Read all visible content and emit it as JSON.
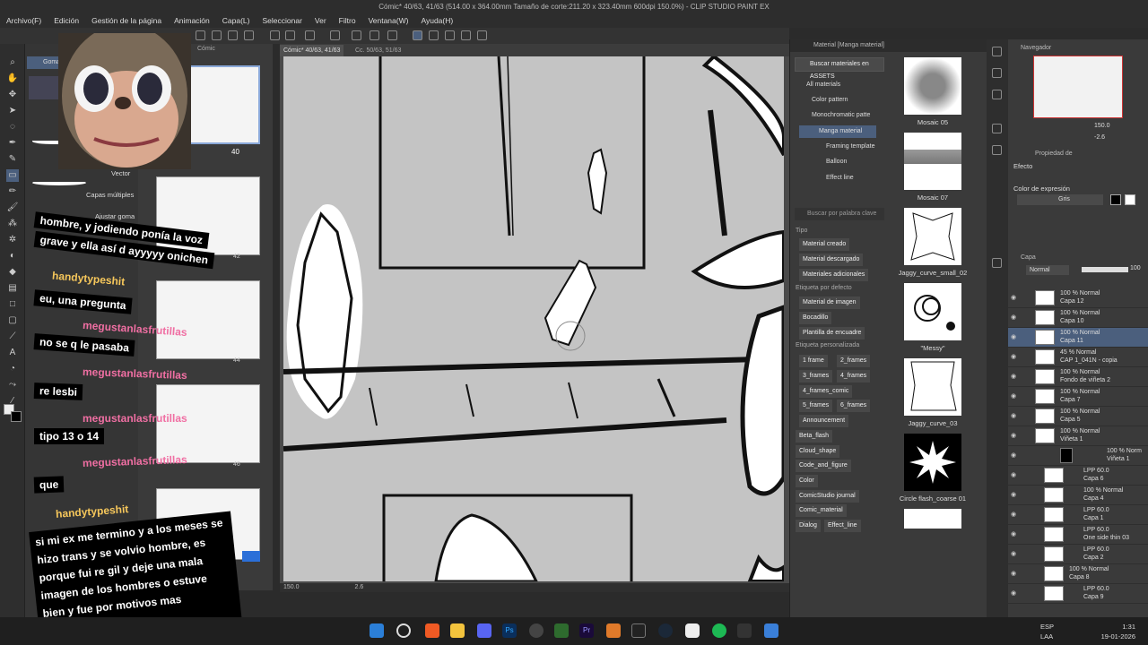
{
  "titlebar": "Cómic* 40/63, 41/63 (514.00 x 364.00mm Tamaño de corte:211.20 x 323.40mm 600dpi 150.0%) - CLIP STUDIO PAINT EX",
  "menu": [
    "Archivo(F)",
    "Edición",
    "Gestión de la página",
    "Animación",
    "Capa(L)",
    "Seleccionar",
    "Ver",
    "Filtro",
    "Ventana(W)",
    "Ayuda(H)"
  ],
  "subtool": {
    "active": "Goma",
    "items": [
      "Vector",
      "Capas múltiples",
      "Ajustar goma"
    ]
  },
  "pages": {
    "tab": "Cómic",
    "labels": [
      "40",
      "42",
      "44",
      "46"
    ]
  },
  "canvas": {
    "tabs": [
      "Cómic* 40/63, 41/63",
      "Cc. 50/63, 51/63"
    ],
    "zoom": "150.0",
    "angle": "2.6"
  },
  "material": {
    "header": "Material [Manga material]",
    "assets_button": "Buscar materiales en ASSETS",
    "tree": [
      "All materials",
      "Color pattern",
      "Monochromatic patte",
      "Manga material",
      "Framing template",
      "Balloon",
      "Effect line"
    ],
    "search_placeholder": "Buscar por palabra clave",
    "sections": [
      "Tipo",
      "Etiqueta por defecto",
      "Etiqueta personalizada"
    ],
    "tags_tipo": [
      "Material creado",
      "Material descargado",
      "Materiales adicionales"
    ],
    "tags_default": [
      "Material de imagen",
      "Bocadillo",
      "Plantilla de encuadre"
    ],
    "tags_custom": [
      "1 frame",
      "2_frames",
      "3_frames",
      "4_frames",
      "4_frames_comic",
      "5_frames",
      "6_frames",
      "Announcement",
      "Beta_flash",
      "Cloud_shape",
      "Code_and_figure",
      "Color",
      "ComicStudio journal",
      "Comic_material",
      "Dialog",
      "Effect_line"
    ],
    "items": [
      "Mosaic 05",
      "Mosaic 07",
      "Jaggy_curve_small_02",
      "\"Messy\"",
      "Jaggy_curve_03",
      "Circle flash_coarse 01"
    ]
  },
  "navigator": {
    "title": "Navegador",
    "zoom": "150.0",
    "angle": "-2.6"
  },
  "props": {
    "title": "Propiedad de",
    "effect": "Efecto",
    "color_label": "Color de expresión",
    "color_value": "Gris"
  },
  "layers": {
    "title": "Capa",
    "blend": "Normal",
    "opacity": "100",
    "items": [
      {
        "l1": "100 % Normal",
        "l2": "Capa 12"
      },
      {
        "l1": "100 % Normal",
        "l2": "Capa 10"
      },
      {
        "l1": "100 % Normal",
        "l2": "Capa 11"
      },
      {
        "l1": "45 % Normal",
        "l2": "CAP 1_041N - copia"
      },
      {
        "l1": "100 % Normal",
        "l2": "Fondo de viñeta 2"
      },
      {
        "l1": "100 % Normal",
        "l2": "Capa 7"
      },
      {
        "l1": "100 % Normal",
        "l2": "Capa 5"
      },
      {
        "l1": "100 % Normal",
        "l2": "Viñeta 1"
      },
      {
        "l1": "100 % Norm",
        "l2": "Viñeta 1"
      },
      {
        "l1": "LPP 60.0",
        "l2": "Capa 6"
      },
      {
        "l1": "100 % Normal",
        "l2": "Capa 4"
      },
      {
        "l1": "LPP 60.0",
        "l2": "Capa 1"
      },
      {
        "l1": "LPP 60.0",
        "l2": "One side thin 03"
      },
      {
        "l1": "LPP 60.0",
        "l2": "Capa 2"
      },
      {
        "l1": "100 % Normal",
        "l2": "Capa 8"
      },
      {
        "l1": "LPP 60.0",
        "l2": "Capa 9"
      }
    ]
  },
  "chat": [
    {
      "user": "",
      "text": "hombre, y  jodiendo ponía la voz"
    },
    {
      "user": "",
      "text": "grave y ella así d ayyyyy onichen"
    },
    {
      "user": "handytypeshit",
      "text": "eu, una pregunta"
    },
    {
      "user": "megustanlasfrutillas",
      "text": "no se q le pasaba"
    },
    {
      "user": "megustanlasfrutillas",
      "text": "re lesbi"
    },
    {
      "user": "megustanlasfrutillas",
      "text": "tipo 13 o 14"
    },
    {
      "user": "megustanlasfrutillas",
      "text": "que"
    },
    {
      "user": "handytypeshit",
      "text": "si mi ex me termino y a los meses se hizo trans y se volvio hombre, es porque fui re gil y deje una mala imagen de los hombres o  estuve bien y fue por motivos mas personales?"
    }
  ],
  "taskbar": {
    "lang1": "ESP",
    "lang2": "LAA",
    "time": "1:31",
    "date": "19-01-2026"
  }
}
